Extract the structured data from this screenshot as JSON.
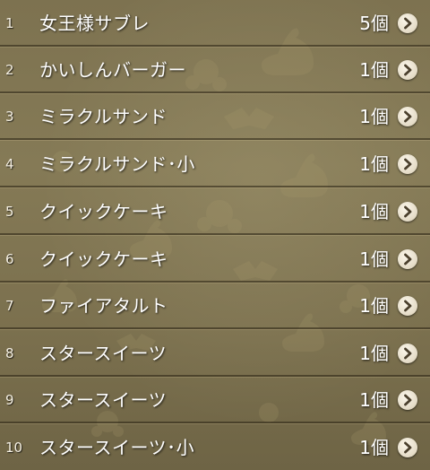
{
  "item_list": {
    "rows": [
      {
        "number": "1",
        "name": "女王様サブレ",
        "quantity": "5個",
        "icon": "chevron-right-icon"
      },
      {
        "number": "2",
        "name": "かいしんバーガー",
        "quantity": "1個",
        "icon": "chevron-right-icon"
      },
      {
        "number": "3",
        "name": "ミラクルサンド",
        "quantity": "1個",
        "icon": "chevron-right-icon"
      },
      {
        "number": "4",
        "name": "ミラクルサンド･小",
        "quantity": "1個",
        "icon": "chevron-right-icon"
      },
      {
        "number": "5",
        "name": "クイックケーキ",
        "quantity": "1個",
        "icon": "chevron-right-icon"
      },
      {
        "number": "6",
        "name": "クイックケーキ",
        "quantity": "1個",
        "icon": "chevron-right-icon"
      },
      {
        "number": "7",
        "name": "ファイアタルト",
        "quantity": "1個",
        "icon": "chevron-right-icon"
      },
      {
        "number": "8",
        "name": "スタースイーツ",
        "quantity": "1個",
        "icon": "chevron-right-icon"
      },
      {
        "number": "9",
        "name": "スタースイーツ",
        "quantity": "1個",
        "icon": "chevron-right-icon"
      },
      {
        "number": "10",
        "name": "スタースイーツ･小",
        "quantity": "1個",
        "icon": "chevron-right-icon"
      }
    ]
  },
  "colors": {
    "background": "#7d7250",
    "text": "#ffffff",
    "divider": "#282012",
    "button": "#ece4d2",
    "button_arrow": "#4a3f2c"
  }
}
